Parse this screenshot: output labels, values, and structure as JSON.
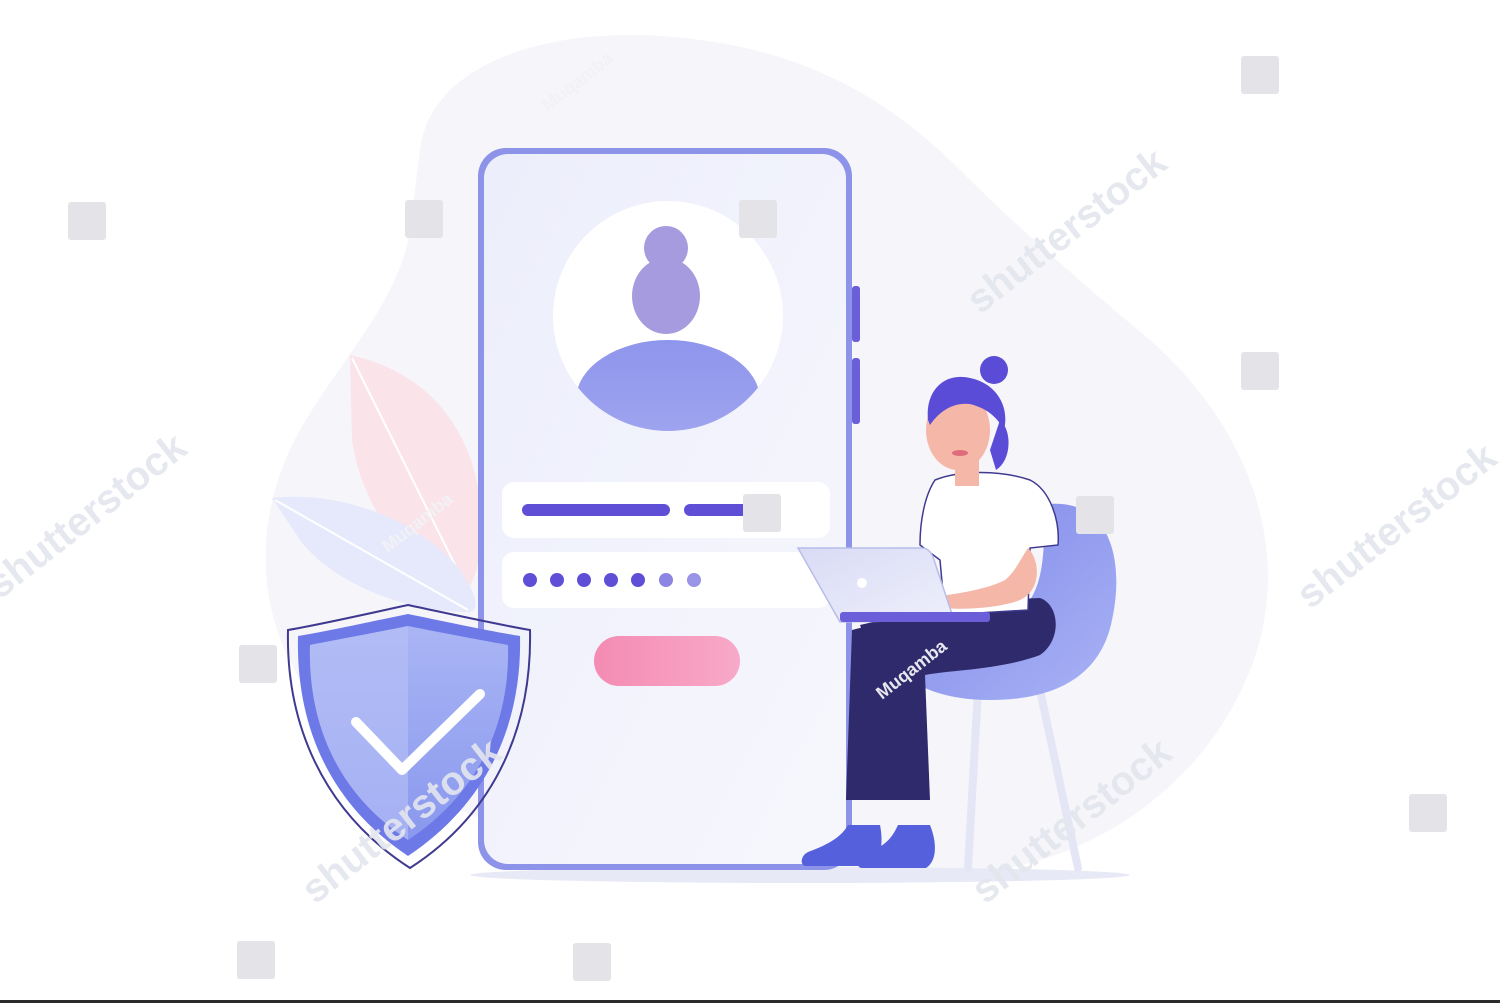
{
  "illustration": {
    "subject": "Woman with laptop signing in; phone login screen with avatar, username and password fields, button; security shield with checkmark",
    "password_dots": 7,
    "colors": {
      "primary_purple": "#6556d8",
      "light_purple": "#9ea4f0",
      "lavender_bg": "#f3f3fb",
      "pink_button": "#f48fb6",
      "navy_pants": "#2e2a6b"
    }
  },
  "watermarks": {
    "brand": "shutterstock",
    "author": "Muqamba"
  }
}
